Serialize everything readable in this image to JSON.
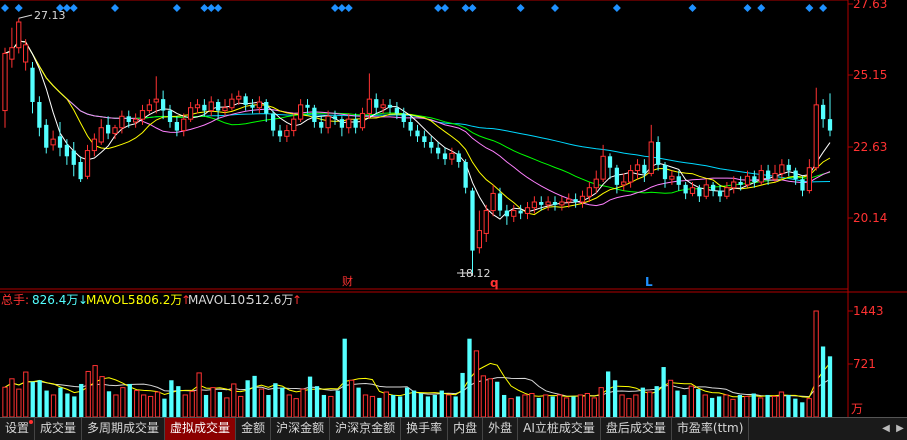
{
  "colors": {
    "up": "#ff3232",
    "down": "#54ffff",
    "ma5": "#ffffff",
    "ma10": "#ffff00",
    "ma20": "#ff80ff",
    "ma30": "#00ff00",
    "ma60": "#00d8ff",
    "axis": "#b00000",
    "grid": "#800000",
    "label": "#ff3232",
    "diamond": "#1e90ff"
  },
  "price_axis": {
    "ticks": [
      "27.63",
      "25.15",
      "22.63",
      "20.14"
    ]
  },
  "annotations": {
    "high_label": "27.13",
    "low_label": "18.12",
    "marker_cai": "财",
    "marker_q": "q",
    "marker_l": "L"
  },
  "volume_header": {
    "total_label": "总手:",
    "total_value": "826.4万",
    "mavol5_label": "MAVOL5:",
    "mavol5_value": "806.2万",
    "mavol10_label": "MAVOL10:",
    "mavol10_value": "512.6万"
  },
  "volume_axis": {
    "ticks": [
      "1443",
      "721"
    ],
    "unit": "万"
  },
  "tabs": [
    {
      "label": "设置",
      "active": false,
      "dot": true
    },
    {
      "label": "成交量",
      "active": false
    },
    {
      "label": "多周期成交量",
      "active": false
    },
    {
      "label": "虚拟成交量",
      "active": true
    },
    {
      "label": "金额",
      "active": false
    },
    {
      "label": "沪深金额",
      "active": false
    },
    {
      "label": "沪深京金额",
      "active": false
    },
    {
      "label": "换手率",
      "active": false
    },
    {
      "label": "内盘",
      "active": false
    },
    {
      "label": "外盘",
      "active": false
    },
    {
      "label": "AI立桩成交量",
      "active": false
    },
    {
      "label": "盘后成交量",
      "active": false
    },
    {
      "label": "市盈率(ttm)",
      "active": false
    }
  ],
  "nav": {
    "left": "◀",
    "right": "▶"
  },
  "chart_data": [
    {
      "type": "candlestick",
      "y_axis": {
        "ticks": [
          27.63,
          25.15,
          22.63,
          20.14
        ],
        "range": [
          17.3,
          27.75
        ]
      },
      "ohlc": [
        [
          23.9,
          25.9,
          26.1,
          23.3
        ],
        [
          25.7,
          26.1,
          26.8,
          25.4
        ],
        [
          26.1,
          27.0,
          27.13,
          25.9
        ],
        [
          25.6,
          26.2,
          26.4,
          25.3
        ],
        [
          25.4,
          24.2,
          25.6,
          23.8
        ],
        [
          24.2,
          23.3,
          24.4,
          23.0
        ],
        [
          23.4,
          22.6,
          23.6,
          22.4
        ],
        [
          22.7,
          22.9,
          23.2,
          22.5
        ],
        [
          23.0,
          22.6,
          23.5,
          22.3
        ],
        [
          22.7,
          22.3,
          22.9,
          22.0
        ],
        [
          22.5,
          22.0,
          22.8,
          21.6
        ],
        [
          22.1,
          21.5,
          22.3,
          21.4
        ],
        [
          21.6,
          22.5,
          22.7,
          21.5
        ],
        [
          22.5,
          22.9,
          23.1,
          22.3
        ],
        [
          22.8,
          23.3,
          23.6,
          22.7
        ],
        [
          23.4,
          23.1,
          23.7,
          22.9
        ],
        [
          23.1,
          23.3,
          23.4,
          22.9
        ],
        [
          23.3,
          23.7,
          23.9,
          23.1
        ],
        [
          23.7,
          23.5,
          23.9,
          23.3
        ],
        [
          23.5,
          23.6,
          23.8,
          23.3
        ],
        [
          23.6,
          23.9,
          24.1,
          23.4
        ],
        [
          23.9,
          24.1,
          24.3,
          23.8
        ],
        [
          24.2,
          24.3,
          25.1,
          23.8
        ],
        [
          24.3,
          23.9,
          24.6,
          23.6
        ],
        [
          23.9,
          23.5,
          24.1,
          23.3
        ],
        [
          23.5,
          23.2,
          23.7,
          23.0
        ],
        [
          23.2,
          23.6,
          23.8,
          23.0
        ],
        [
          23.6,
          24.0,
          24.2,
          23.5
        ],
        [
          24.0,
          24.1,
          24.3,
          23.8
        ],
        [
          24.1,
          23.9,
          24.3,
          23.7
        ],
        [
          23.9,
          24.2,
          24.4,
          23.7
        ],
        [
          24.2,
          23.9,
          24.3,
          23.6
        ],
        [
          23.9,
          24.0,
          24.3,
          23.7
        ],
        [
          24.0,
          24.3,
          24.5,
          23.9
        ],
        [
          24.3,
          24.4,
          24.6,
          24.1
        ],
        [
          24.4,
          24.1,
          24.5,
          23.9
        ],
        [
          24.1,
          24.0,
          24.3,
          23.8
        ],
        [
          24.0,
          24.2,
          24.4,
          23.8
        ],
        [
          24.2,
          23.8,
          24.3,
          23.5
        ],
        [
          23.8,
          23.2,
          23.9,
          23.0
        ],
        [
          23.2,
          23.0,
          23.4,
          22.8
        ],
        [
          23.0,
          23.2,
          23.4,
          22.8
        ],
        [
          23.2,
          23.6,
          23.8,
          23.0
        ],
        [
          23.6,
          24.1,
          24.3,
          23.5
        ],
        [
          24.1,
          24.0,
          24.3,
          23.8
        ],
        [
          24.0,
          23.5,
          24.1,
          23.3
        ],
        [
          23.5,
          23.3,
          23.7,
          23.1
        ],
        [
          23.3,
          23.7,
          23.9,
          23.1
        ],
        [
          23.7,
          23.6,
          23.9,
          23.4
        ],
        [
          23.6,
          23.3,
          23.7,
          23.0
        ],
        [
          23.3,
          23.6,
          23.8,
          23.1
        ],
        [
          23.6,
          23.3,
          23.8,
          23.1
        ],
        [
          23.3,
          23.8,
          24.0,
          23.2
        ],
        [
          23.8,
          24.3,
          25.2,
          23.6
        ],
        [
          24.3,
          24.0,
          24.5,
          23.8
        ],
        [
          24.0,
          24.1,
          24.3,
          23.8
        ],
        [
          24.1,
          24.0,
          24.3,
          23.8
        ],
        [
          24.0,
          23.8,
          24.2,
          23.6
        ],
        [
          23.8,
          23.5,
          24.0,
          23.3
        ],
        [
          23.5,
          23.2,
          23.7,
          23.0
        ],
        [
          23.2,
          23.0,
          23.4,
          22.8
        ],
        [
          23.0,
          22.8,
          23.2,
          22.6
        ],
        [
          22.8,
          22.6,
          23.0,
          22.4
        ],
        [
          22.6,
          22.4,
          22.8,
          22.2
        ],
        [
          22.4,
          22.2,
          22.6,
          22.0
        ],
        [
          22.2,
          22.4,
          22.6,
          22.0
        ],
        [
          22.4,
          22.1,
          22.5,
          21.9
        ],
        [
          22.1,
          21.2,
          22.2,
          21.0
        ],
        [
          21.1,
          19.0,
          21.2,
          18.12
        ],
        [
          19.1,
          19.7,
          20.4,
          18.9
        ],
        [
          19.6,
          20.4,
          20.6,
          19.3
        ],
        [
          20.4,
          21.0,
          21.3,
          20.2
        ],
        [
          21.0,
          20.4,
          21.2,
          20.2
        ],
        [
          20.4,
          20.2,
          20.6,
          19.9
        ],
        [
          20.2,
          20.4,
          20.6,
          20.0
        ],
        [
          20.4,
          20.3,
          20.6,
          20.1
        ],
        [
          20.3,
          20.5,
          20.7,
          20.1
        ],
        [
          20.5,
          20.7,
          20.9,
          20.3
        ],
        [
          20.7,
          20.6,
          20.9,
          20.4
        ],
        [
          20.6,
          20.7,
          20.9,
          20.4
        ],
        [
          20.7,
          20.6,
          20.9,
          20.4
        ],
        [
          20.6,
          20.7,
          20.9,
          20.4
        ],
        [
          20.7,
          20.8,
          21.0,
          20.5
        ],
        [
          20.8,
          20.7,
          21.0,
          20.5
        ],
        [
          20.7,
          20.9,
          21.1,
          20.5
        ],
        [
          20.9,
          21.2,
          21.4,
          20.7
        ],
        [
          21.2,
          21.5,
          21.8,
          21.0
        ],
        [
          21.5,
          22.3,
          22.7,
          21.4
        ],
        [
          22.3,
          21.9,
          22.4,
          21.5
        ],
        [
          21.9,
          21.3,
          22.0,
          21.0
        ],
        [
          21.3,
          21.4,
          21.7,
          21.1
        ],
        [
          21.4,
          21.8,
          22.0,
          21.2
        ],
        [
          21.8,
          22.0,
          22.2,
          21.5
        ],
        [
          22.0,
          21.7,
          22.2,
          21.4
        ],
        [
          21.7,
          22.8,
          23.4,
          21.6
        ],
        [
          22.8,
          22.0,
          23.0,
          21.8
        ],
        [
          22.0,
          21.5,
          22.1,
          21.2
        ],
        [
          21.5,
          21.6,
          21.8,
          21.3
        ],
        [
          21.6,
          21.3,
          21.8,
          21.1
        ],
        [
          21.3,
          21.0,
          21.4,
          20.8
        ],
        [
          21.0,
          21.2,
          21.4,
          20.9
        ],
        [
          21.2,
          20.9,
          21.3,
          20.7
        ],
        [
          20.9,
          21.3,
          21.5,
          20.8
        ],
        [
          21.3,
          21.1,
          21.4,
          20.9
        ],
        [
          21.1,
          20.9,
          21.3,
          20.7
        ],
        [
          20.9,
          21.2,
          21.4,
          20.8
        ],
        [
          21.2,
          21.4,
          21.6,
          21.0
        ],
        [
          21.4,
          21.3,
          21.6,
          21.1
        ],
        [
          21.3,
          21.6,
          21.8,
          21.2
        ],
        [
          21.6,
          21.4,
          21.8,
          21.2
        ],
        [
          21.4,
          21.8,
          22.0,
          21.3
        ],
        [
          21.8,
          21.5,
          22.0,
          21.3
        ],
        [
          21.5,
          21.7,
          22.0,
          21.4
        ],
        [
          21.7,
          22.0,
          22.2,
          21.5
        ],
        [
          22.0,
          21.8,
          22.2,
          21.6
        ],
        [
          21.8,
          21.5,
          21.9,
          21.3
        ],
        [
          21.5,
          21.1,
          21.6,
          20.9
        ],
        [
          21.1,
          21.9,
          22.2,
          21.0
        ],
        [
          21.9,
          24.1,
          24.7,
          21.8
        ],
        [
          24.1,
          23.6,
          24.3,
          23.3
        ],
        [
          23.6,
          23.2,
          24.5,
          23.0
        ]
      ]
    },
    {
      "type": "bar",
      "series": "volume",
      "y_axis": {
        "ticks": [
          1443,
          721
        ],
        "unit": "万"
      },
      "values": [
        405,
        520,
        380,
        612,
        480,
        500,
        360,
        300,
        400,
        320,
        280,
        450,
        620,
        700,
        550,
        350,
        300,
        400,
        450,
        360,
        300,
        280,
        340,
        250,
        500,
        420,
        300,
        350,
        600,
        300,
        400,
        340,
        260,
        450,
        280,
        500,
        560,
        380,
        300,
        460,
        400,
        300,
        250,
        380,
        550,
        420,
        300,
        280,
        360,
        1066,
        500,
        400,
        300,
        280,
        260,
        340,
        300,
        280,
        400,
        360,
        320,
        280,
        300,
        360,
        300,
        280,
        600,
        1066,
        900,
        560,
        520,
        480,
        300,
        250,
        280,
        300,
        320,
        260,
        300,
        280,
        300,
        260,
        280,
        300,
        320,
        260,
        400,
        620,
        500,
        300,
        250,
        300,
        400,
        340,
        420,
        680,
        500,
        360,
        300,
        420,
        380,
        300,
        260,
        280,
        300,
        240,
        300,
        280,
        320,
        260,
        300,
        280,
        340,
        300,
        250,
        200,
        250,
        1443,
        960,
        826
      ]
    }
  ]
}
